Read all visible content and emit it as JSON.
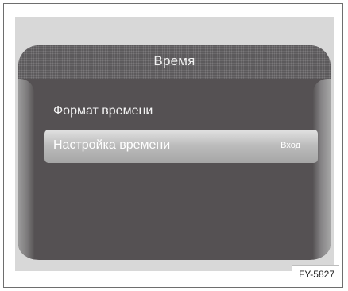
{
  "screen": {
    "title": "Время",
    "items": [
      {
        "label": "Формат времени"
      },
      {
        "label": "Настройка времени",
        "action": "Вход",
        "selected": true
      }
    ]
  },
  "figure_code": "FY-5827"
}
